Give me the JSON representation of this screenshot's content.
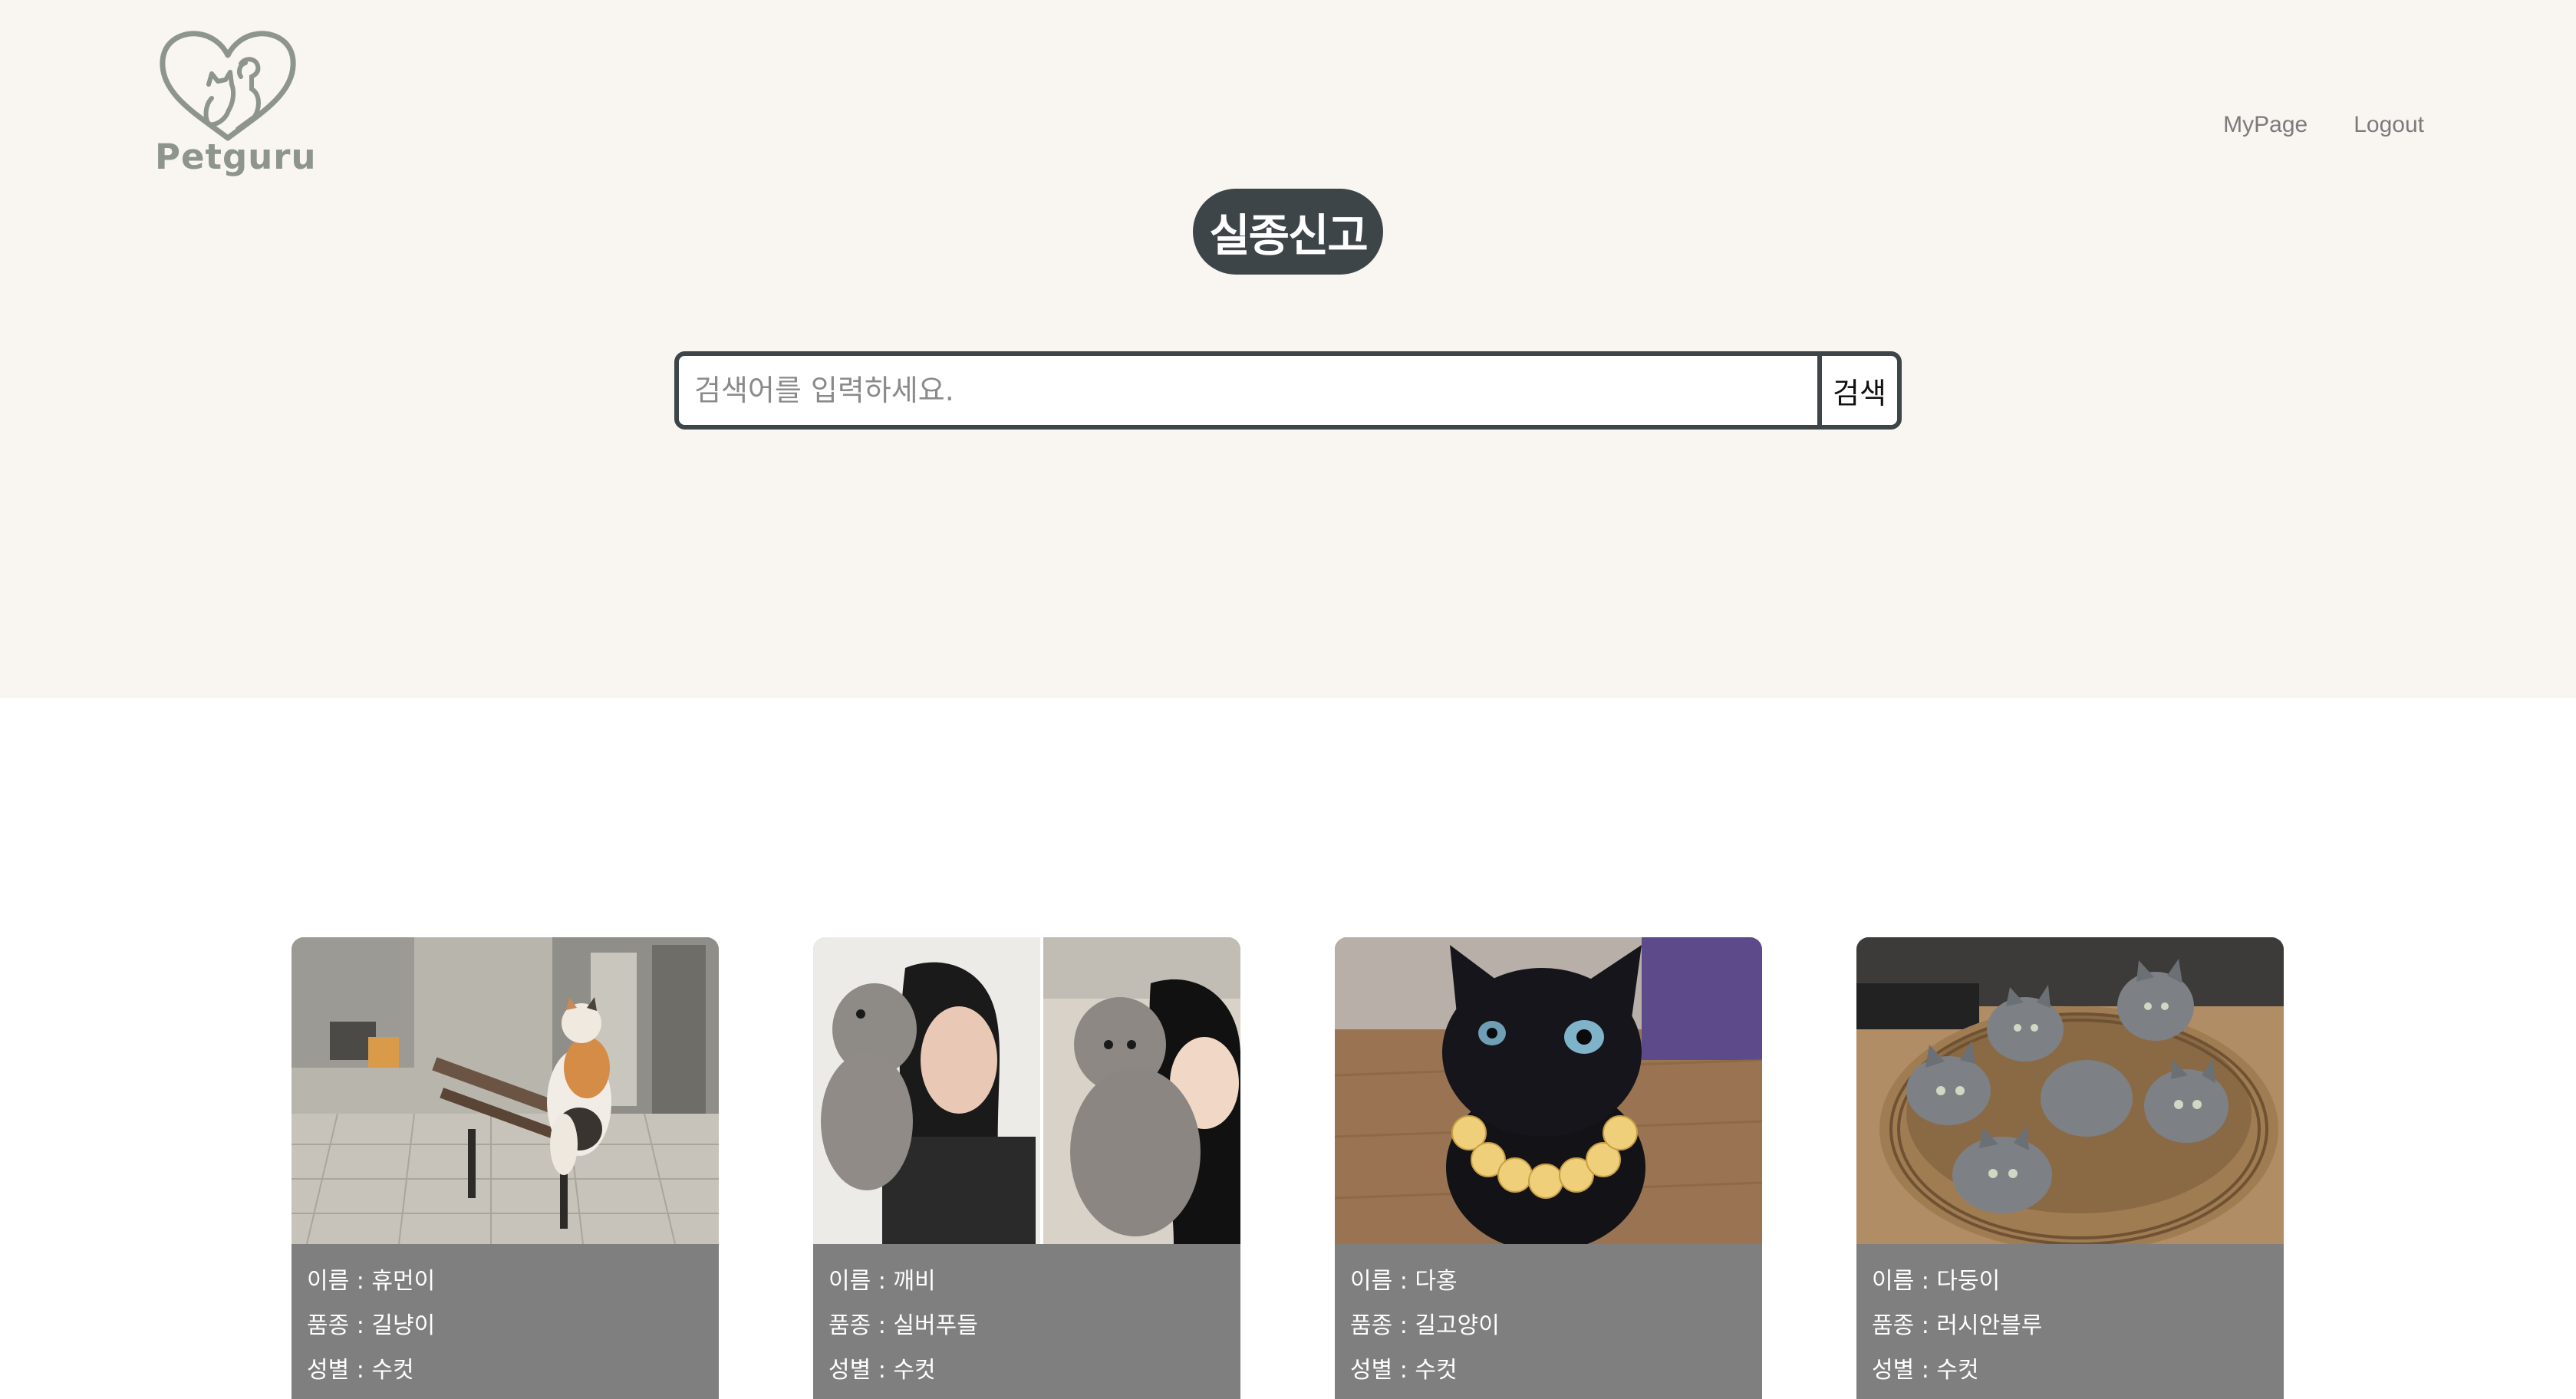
{
  "header": {
    "logo_text": "Petguru",
    "nav": {
      "mypage": "MyPage",
      "logout": "Logout"
    }
  },
  "hero": {
    "title": "실종신고",
    "search": {
      "placeholder": "검색어를 입력하세요.",
      "value": "",
      "button_label": "검색"
    }
  },
  "colors": {
    "hero_bg": "#f9f5f1",
    "accent_dark": "#3d4548",
    "card_info_bg": "#7f7f7f",
    "logo_gray": "#8d958d"
  },
  "cards": [
    {
      "name_label": "이름",
      "name": "휴먼이",
      "breed_label": "품종",
      "breed": "길냥이",
      "sex_label": "성별",
      "sex": "수컷",
      "photo": "calico-cat-on-bench"
    },
    {
      "name_label": "이름",
      "name": "깨비",
      "breed_label": "품종",
      "breed": "실버푸들",
      "sex_label": "성별",
      "sex": "수컷",
      "photo": "silver-poodle-with-owners"
    },
    {
      "name_label": "이름",
      "name": "다홍",
      "breed_label": "품종",
      "breed": "길고양이",
      "sex_label": "성별",
      "sex": "수컷",
      "photo": "black-cat-with-collar"
    },
    {
      "name_label": "이름",
      "name": "다둥이",
      "breed_label": "품종",
      "breed": "러시안블루",
      "sex_label": "성별",
      "sex": "수컷",
      "photo": "russian-blue-kittens-in-basket"
    }
  ]
}
